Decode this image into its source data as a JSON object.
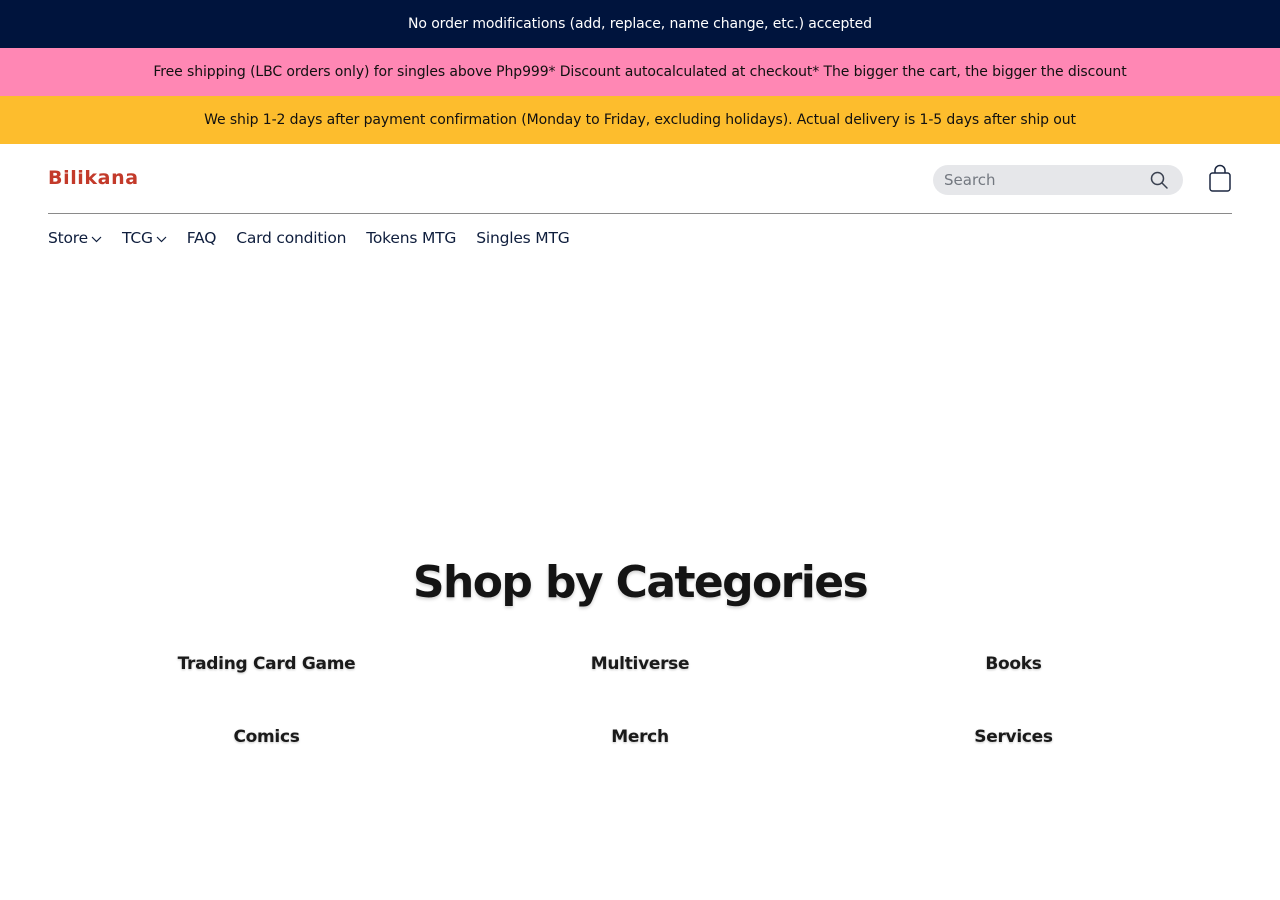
{
  "banners": {
    "one": "No order modifications (add, replace, name change, etc.) accepted",
    "two": "Free shipping (LBC orders only) for singles above Php999* Discount autocalculated at checkout* The bigger the cart, the bigger the discount",
    "three": "We ship 1-2 days after payment confirmation (Monday to Friday, excluding holidays). Actual delivery is 1-5 days after ship out"
  },
  "header": {
    "logo": "Bilikana",
    "search_placeholder": "Search",
    "search_icon": "search-icon",
    "cart_icon": "shopping-bag-icon"
  },
  "nav": {
    "items": [
      {
        "label": "Store",
        "dropdown": true
      },
      {
        "label": "TCG",
        "dropdown": true
      },
      {
        "label": "FAQ",
        "dropdown": false
      },
      {
        "label": "Card condition",
        "dropdown": false
      },
      {
        "label": "Tokens MTG",
        "dropdown": false
      },
      {
        "label": "Singles MTG",
        "dropdown": false
      }
    ]
  },
  "categories": {
    "title": "Shop by Categories",
    "items": [
      "Trading Card Game",
      "Multiverse",
      "Books",
      "Comics",
      "Merch",
      "Services"
    ]
  },
  "colors": {
    "banner_navy": "#00143d",
    "banner_pink": "#ff87b4",
    "banner_yellow": "#fdbd2d",
    "logo_red": "#c33a2a",
    "nav_text": "#0f1e3d"
  }
}
